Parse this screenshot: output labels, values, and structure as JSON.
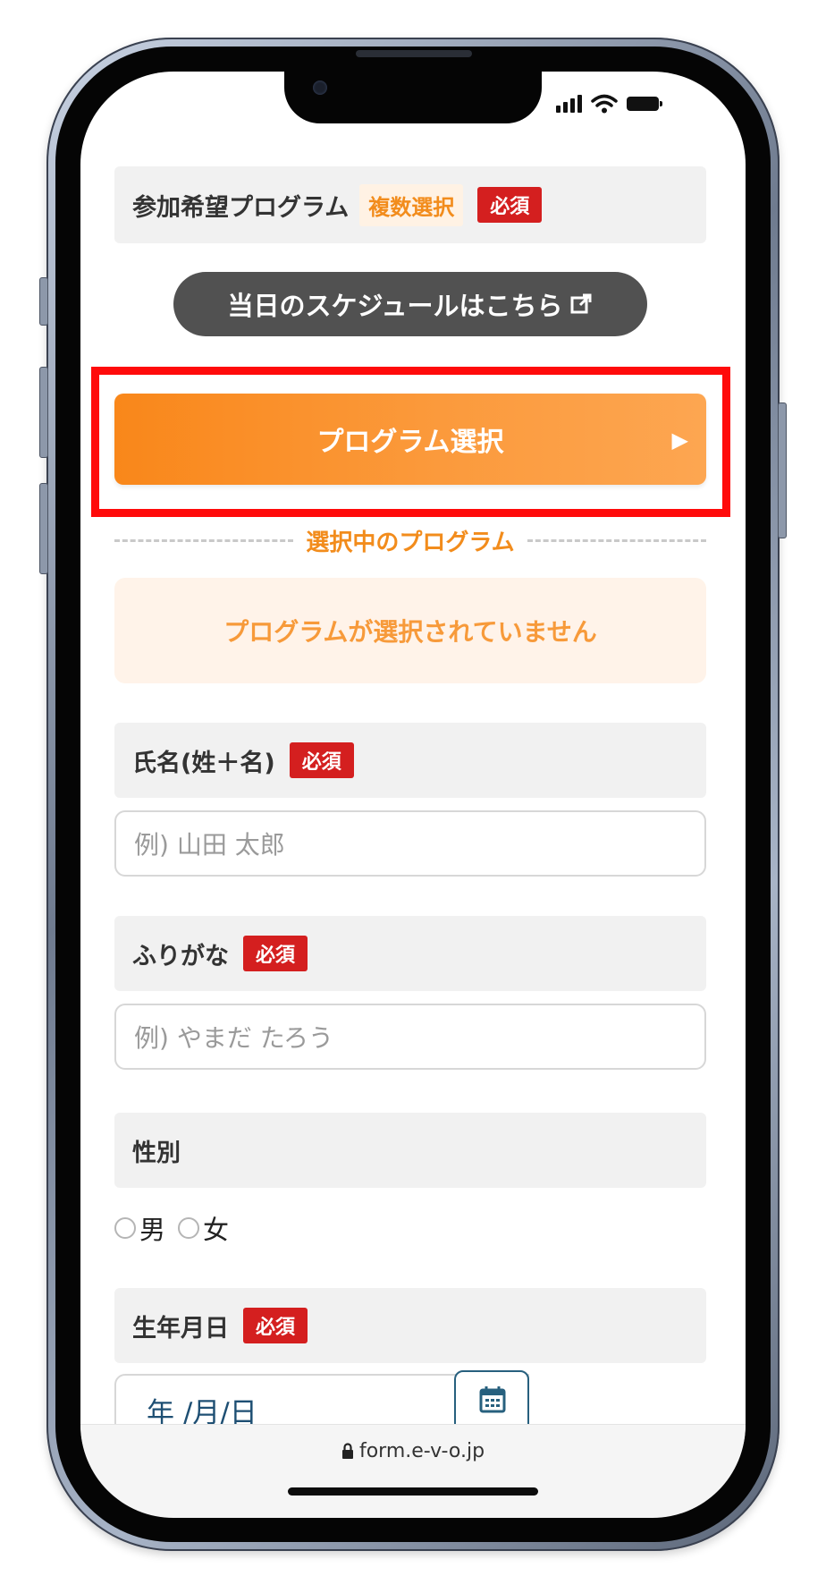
{
  "status_bar": {
    "icons": [
      "cellular-signal-icon",
      "wifi-icon",
      "battery-icon"
    ]
  },
  "colors": {
    "accent": "#f9871a",
    "required": "#d41f1f",
    "highlight": "#ff0b0b",
    "dark_button": "#515151"
  },
  "program_section": {
    "label": "参加希望プログラム",
    "multi_tag": "複数選択",
    "required_tag": "必須",
    "schedule_button": "当日のスケジュールはこちら",
    "select_button": "プログラム選択",
    "selected_title": "選択中のプログラム",
    "empty_message": "プログラムが選択されていません"
  },
  "name_field": {
    "label": "氏名(姓＋名)",
    "required_tag": "必須",
    "placeholder": "例) 山田 太郎"
  },
  "furigana_field": {
    "label": "ふりがな",
    "required_tag": "必須",
    "placeholder": "例) やまだ たろう"
  },
  "gender_field": {
    "label": "性別",
    "options": [
      "男",
      "女"
    ]
  },
  "birthday_field": {
    "label": "生年月日",
    "required_tag": "必須",
    "value": "年 /月/日"
  },
  "browser": {
    "url": "form.e-v-o.jp"
  }
}
